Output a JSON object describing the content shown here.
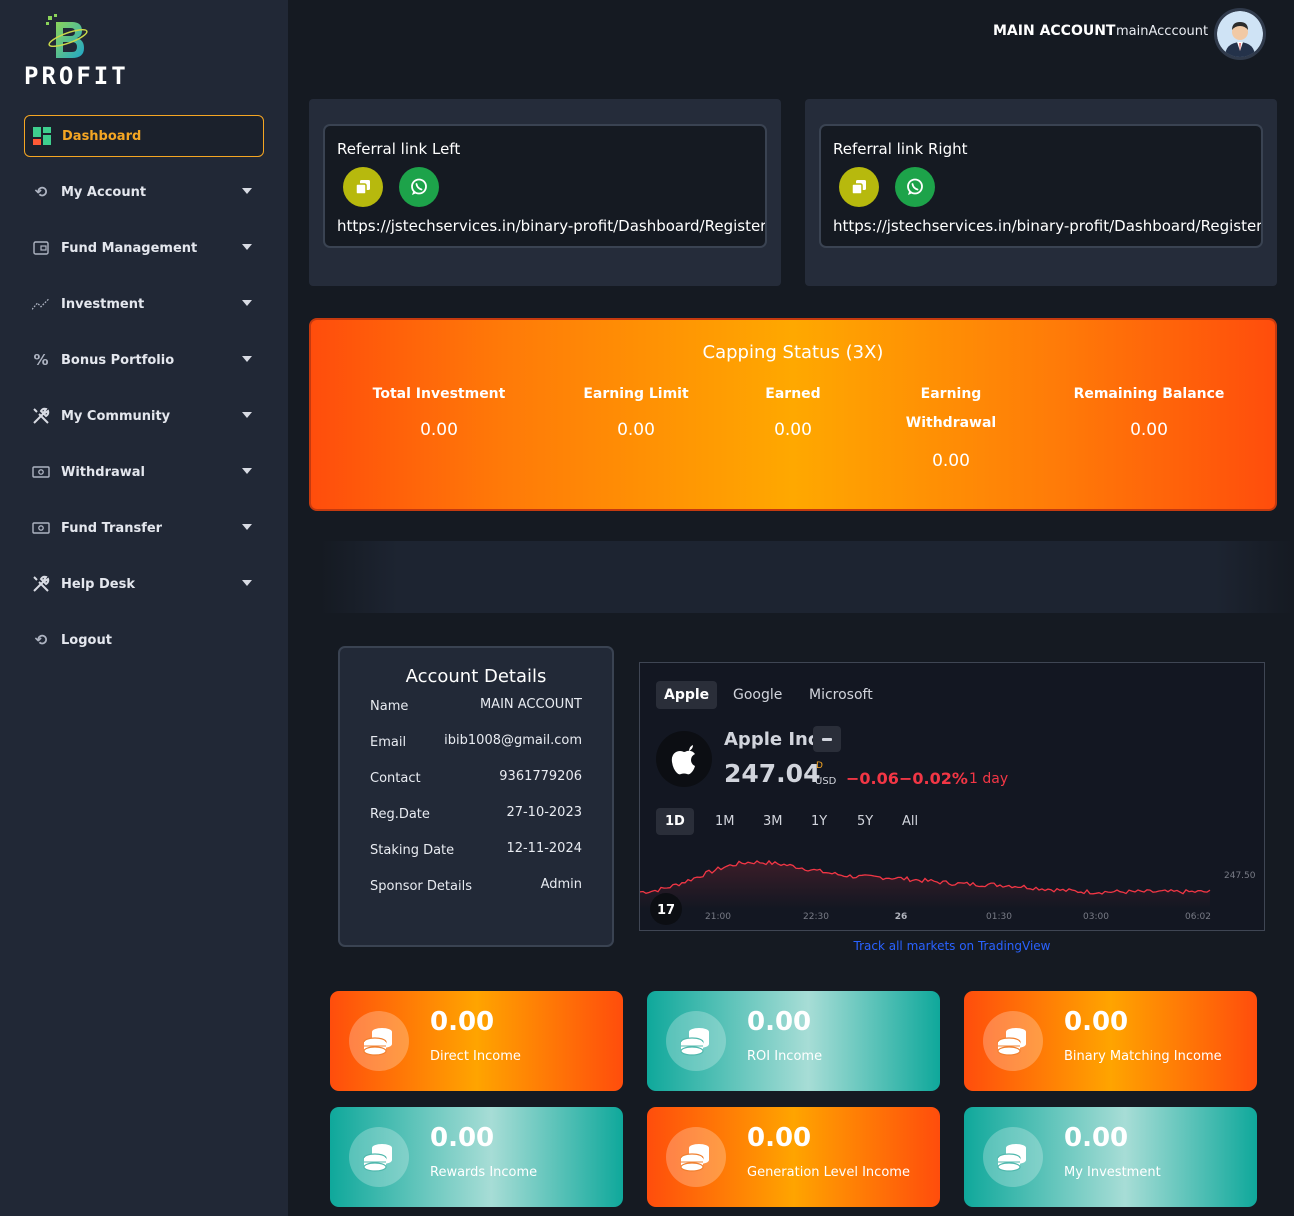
{
  "brand": {
    "name": "PROFIT"
  },
  "sidebar": {
    "items": [
      {
        "label": "Dashboard"
      },
      {
        "label": "My Account"
      },
      {
        "label": "Fund Management"
      },
      {
        "label": "Investment"
      },
      {
        "label": "Bonus Portfolio"
      },
      {
        "label": "My Community"
      },
      {
        "label": "Withdrawal"
      },
      {
        "label": "Fund Transfer"
      },
      {
        "label": "Help Desk"
      },
      {
        "label": "Logout"
      }
    ]
  },
  "header": {
    "account_name": "MAIN ACCOUNT",
    "username": "mainAcccount"
  },
  "referral": {
    "left": {
      "title": "Referral link Left",
      "url": "https://jstechservices.in/binary-profit/Dashboard/Register/?sponsor=mainAcccount&position=left"
    },
    "right": {
      "title": "Referral link Right",
      "url": "https://jstechservices.in/binary-profit/Dashboard/Register/?sponsor=mainAcccount&position=right"
    }
  },
  "capping": {
    "title": "Capping Status (3X)",
    "total_investment": {
      "label": "Total Investment",
      "value": "0.00"
    },
    "earning_limit": {
      "label": "Earning Limit",
      "value": "0.00"
    },
    "earned": {
      "label": "Earned",
      "value": "0.00"
    },
    "earning_withdrawal": {
      "label_line1": "Earning",
      "label_line2": "Withdrawal",
      "value": "0.00"
    },
    "remaining_balance": {
      "label": "Remaining Balance",
      "value": "0.00"
    }
  },
  "account_details": {
    "title": "Account Details",
    "rows": [
      {
        "label": "Name",
        "value": "MAIN ACCOUNT"
      },
      {
        "label": "Email",
        "value": "ibib1008@gmail.com"
      },
      {
        "label": "Contact",
        "value": "9361779206"
      },
      {
        "label": "Reg.Date",
        "value": "27-10-2023"
      },
      {
        "label": "Staking Date",
        "value": "12-11-2024"
      },
      {
        "label": "Sponsor Details",
        "value": "Admin"
      }
    ]
  },
  "stock_widget": {
    "tabs": [
      "Apple",
      "Google",
      "Microsoft"
    ],
    "symbol_name": "Apple Inc",
    "price": "247.04",
    "price_flag": "D",
    "currency": "USD",
    "change": "−0.06",
    "change_pct": "−0.02%",
    "period": "1 day",
    "ranges": [
      "1D",
      "1M",
      "3M",
      "1Y",
      "5Y",
      "All"
    ],
    "time_labels": [
      "21:00",
      "22:30",
      "26",
      "01:30",
      "03:00",
      "06:02"
    ],
    "price_label": "247.50",
    "track_link": "Track all markets on TradingView",
    "line_color": "#f23645"
  },
  "chart_data": {
    "type": "line",
    "x": [
      "21:00",
      "22:30",
      "26",
      "01:30",
      "03:00",
      "06:02"
    ],
    "series": [
      {
        "values": [
          246.9,
          247.3,
          247.1,
          247.0,
          246.9,
          246.9
        ]
      }
    ]
  },
  "stats": [
    {
      "value": "0.00",
      "label": "Direct Income",
      "theme": "orange"
    },
    {
      "value": "0.00",
      "label": "ROI Income",
      "theme": "teal"
    },
    {
      "value": "0.00",
      "label": "Binary Matching Income",
      "theme": "orange"
    },
    {
      "value": "0.00",
      "label": "Rewards Income",
      "theme": "teal"
    },
    {
      "value": "0.00",
      "label": "Generation Level Income",
      "theme": "orange"
    },
    {
      "value": "0.00",
      "label": "My Investment",
      "theme": "teal"
    }
  ],
  "colors": {
    "accent": "#f5a623",
    "sidebar_bg": "#212836",
    "page_bg": "#151a22",
    "orange": "#ff4d0c",
    "teal": "#0fa89b"
  },
  "icons": {
    "dashboard": "dashboard-grid-icon",
    "my_account": "refresh-icon",
    "fund_management": "wallet-icon",
    "investment": "trend-icon",
    "bonus_portfolio": "percent-icon",
    "my_community": "tools-icon",
    "withdrawal": "cash-icon",
    "fund_transfer": "cash-icon",
    "help_desk": "tools-icon",
    "logout": "refresh-icon"
  }
}
